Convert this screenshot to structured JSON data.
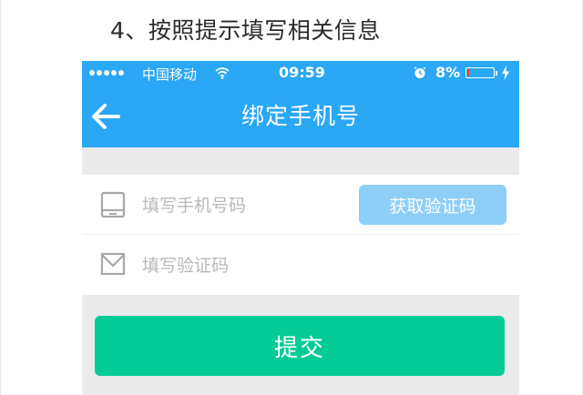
{
  "caption": "4、按照提示填写相关信息",
  "status_bar": {
    "carrier": "中国移动",
    "time": "09:59",
    "battery_percent": "8%",
    "battery_level": 0.08,
    "icons": [
      "signal-dots-icon",
      "wifi-icon",
      "alarm-icon",
      "battery-icon",
      "charging-bolt-icon"
    ]
  },
  "nav": {
    "title": "绑定手机号",
    "back_icon": "arrow-left-icon"
  },
  "form": {
    "phone_placeholder": "填写手机号码",
    "phone_value": "",
    "phone_icon": "phone-icon",
    "code_placeholder": "填写验证码",
    "code_value": "",
    "code_icon": "envelope-icon",
    "get_code_label": "获取验证码"
  },
  "submit_label": "提交",
  "colors": {
    "header_blue": "#2aa7f5",
    "get_code_button": "#8ecff7",
    "submit_green": "#05cc96",
    "page_gray": "#ebebeb"
  }
}
